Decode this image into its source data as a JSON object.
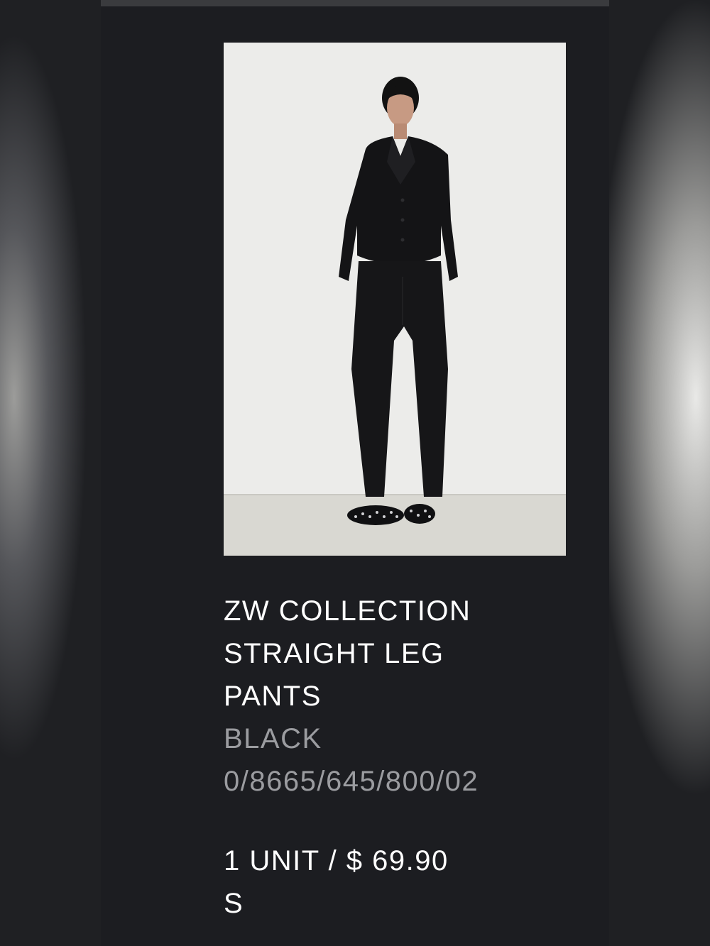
{
  "product": {
    "title": "ZW COLLECTION STRAIGHT LEG PANTS",
    "title_lines": [
      "ZW COLLECTION",
      "STRAIGHT LEG",
      "PANTS"
    ],
    "color": "BLACK",
    "reference": "0/8665/645/800/02",
    "quantity_price": "1 UNIT / $ 69.90",
    "size": "S",
    "image_icon": "product-photo-model-black-suit"
  },
  "colors": {
    "background": "#1c1d21",
    "text": "#ffffff",
    "muted_text": "#9b9ca0",
    "photo_wall": "#ececea",
    "photo_floor": "#d9d8d2"
  }
}
